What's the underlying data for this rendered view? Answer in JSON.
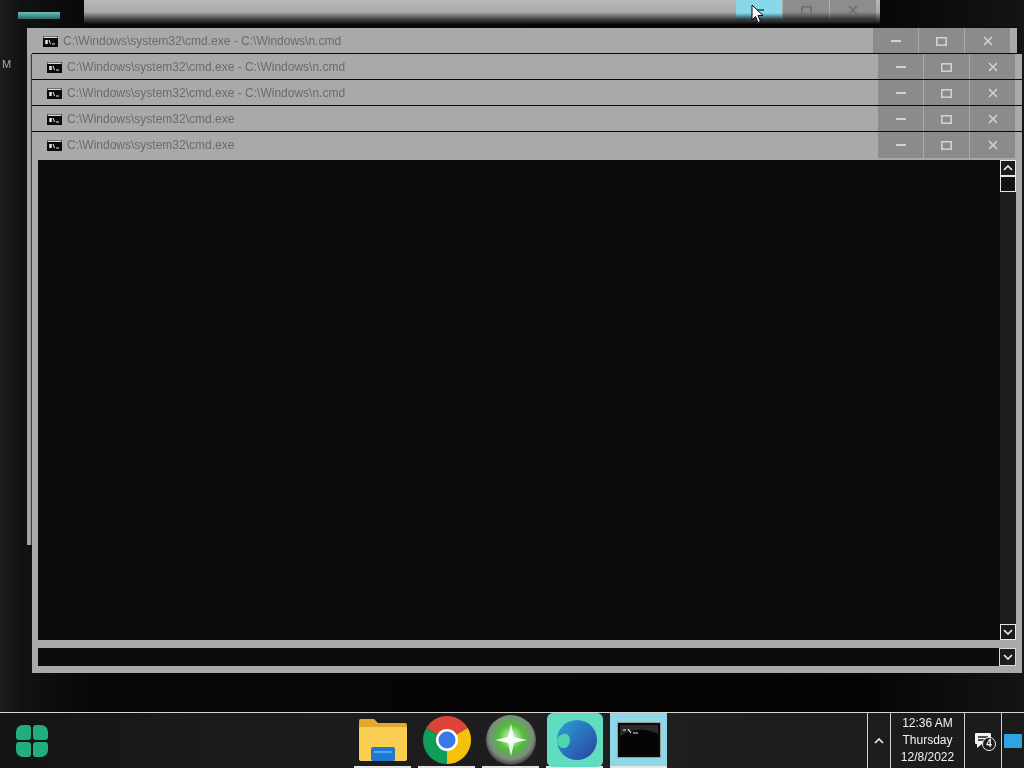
{
  "desktop": {
    "label": "M"
  },
  "background_window": {
    "buttons": [
      {
        "kind": "minimize",
        "hovered": true
      },
      {
        "kind": "maximize",
        "hovered": false
      },
      {
        "kind": "close",
        "hovered": false
      }
    ]
  },
  "windows": [
    {
      "title": "C:\\Windows\\system32\\cmd.exe - C:\\Windows\\n.cmd"
    },
    {
      "title": "C:\\Windows\\system32\\cmd.exe - C:\\Windows\\n.cmd"
    },
    {
      "title": "C:\\Windows\\system32\\cmd.exe - C:\\Windows\\n.cmd"
    },
    {
      "title": "C:\\Windows\\system32\\cmd.exe"
    },
    {
      "title": "C:\\Windows\\system32\\cmd.exe"
    }
  ],
  "taskbar": {
    "apps": [
      {
        "kind": "folder",
        "selected": false,
        "running": true
      },
      {
        "kind": "browser",
        "selected": false,
        "running": true
      },
      {
        "kind": "orb",
        "selected": false,
        "running": true
      },
      {
        "kind": "globe",
        "selected": false,
        "running": true
      },
      {
        "kind": "terminal",
        "selected": true,
        "running": true
      }
    ],
    "clock": {
      "time": "12:36 AM",
      "day": "Thursday",
      "date": "12/8/2022"
    },
    "notifications": {
      "count": "4"
    }
  }
}
